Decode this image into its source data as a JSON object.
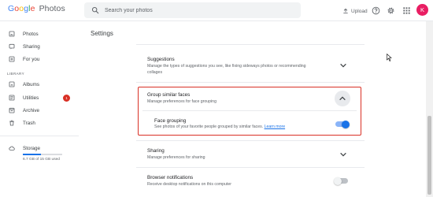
{
  "header": {
    "logo": {
      "g": "G",
      "o1": "o",
      "o2": "o",
      "g2": "g",
      "l": "l",
      "e": "e",
      "photos": "Photos"
    },
    "search": {
      "placeholder": "Search your photos"
    },
    "upload_label": "Upload",
    "avatar_letter": "K"
  },
  "sidebar": {
    "items": [
      {
        "label": "Photos",
        "icon": "photos-icon"
      },
      {
        "label": "Sharing",
        "icon": "sharing-icon"
      },
      {
        "label": "For you",
        "icon": "for-you-icon"
      }
    ],
    "library_label": "LIBRARY",
    "library_items": [
      {
        "label": "Albums",
        "icon": "albums-icon"
      },
      {
        "label": "Utilities",
        "icon": "utilities-icon",
        "badge": "1"
      },
      {
        "label": "Archive",
        "icon": "archive-icon"
      },
      {
        "label": "Trash",
        "icon": "trash-icon"
      }
    ],
    "storage": {
      "label": "Storage",
      "text": "6.7 GB of 15 GB used",
      "used_fraction": 0.45
    }
  },
  "main": {
    "title": "Settings",
    "sections": {
      "suggestions": {
        "title": "Suggestions",
        "desc": "Manage the types of suggestions you see, like fixing sideways photos or recommending collages"
      },
      "group_faces": {
        "title": "Group similar faces",
        "desc": "Manage preferences for face grouping",
        "face_grouping": {
          "title": "Face grouping",
          "desc": "See photos of your favorite people grouped by similar faces.",
          "link": "Learn more",
          "enabled": true
        }
      },
      "sharing": {
        "title": "Sharing",
        "desc": "Manage preferences for sharing"
      },
      "browser_notifications": {
        "title": "Browser notifications",
        "desc": "Receive desktop notifications on this computer",
        "enabled": false
      }
    }
  },
  "colors": {
    "accent": "#1a73e8",
    "highlight": "#d93025",
    "badge": "#d93025"
  }
}
